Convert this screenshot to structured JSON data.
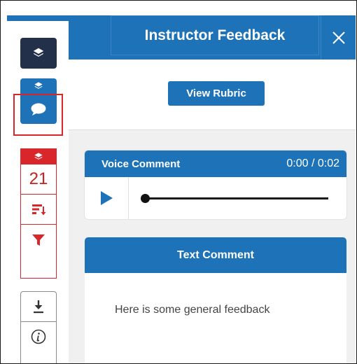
{
  "header": {
    "title": "Instructor Feedback",
    "close_icon": "close-icon"
  },
  "rail": {
    "layers_icon": "layers-icon",
    "feedback_icon": "speech-bubble-icon",
    "annotation_count": "21",
    "sort_icon": "sort-icon",
    "filter_icon": "filter-icon",
    "download_icon": "download-icon",
    "info_icon": "info-icon"
  },
  "panel": {
    "view_rubric_label": "View Rubric",
    "voice_comment": {
      "title": "Voice Comment",
      "time": "0:00 / 0:02",
      "progress": 0.0
    },
    "text_comment": {
      "title": "Text Comment",
      "body": "Here is some general feedback"
    }
  },
  "colors": {
    "primary_blue": "#1e72b8",
    "dark_navy": "#22304a",
    "alert_red": "#d9262a",
    "highlight_red": "#d9262a"
  }
}
